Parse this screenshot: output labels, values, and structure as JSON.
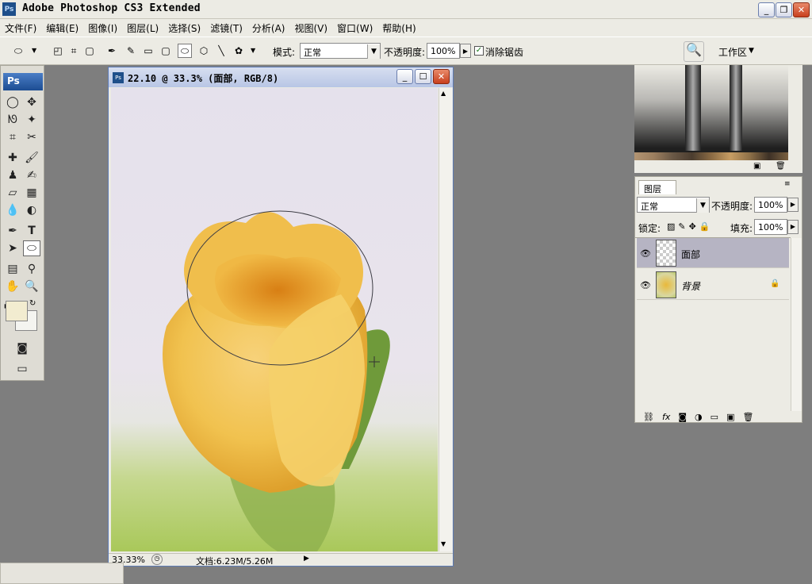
{
  "app": {
    "title": "Adobe Photoshop CS3 Extended",
    "logo": "Ps"
  },
  "window_buttons": {
    "minimize": "_",
    "restore": "❐",
    "close": "✕"
  },
  "menu": [
    "文件(F)",
    "编辑(E)",
    "图像(I)",
    "图层(L)",
    "选择(S)",
    "滤镜(T)",
    "分析(A)",
    "视图(V)",
    "窗口(W)",
    "帮助(H)"
  ],
  "options": {
    "mode_label": "模式:",
    "mode_value": "正常",
    "opacity_label": "不透明度:",
    "opacity_value": "100%",
    "antialias_label": "消除锯齿",
    "workspace_label": "工作区"
  },
  "toolbox": {
    "logo": "Ps"
  },
  "document": {
    "title": "22.10 @ 33.3% (面部, RGB/8)",
    "zoom": "33.33%",
    "doc_size": "文档:6.23M/5.26M"
  },
  "layers_panel": {
    "tab_label": "图层",
    "blend_mode": "正常",
    "opacity_label": "不透明度:",
    "opacity_value": "100%",
    "lock_label": "锁定:",
    "fill_label": "填充:",
    "fill_value": "100%",
    "layers": [
      {
        "name": "面部",
        "selected": true
      },
      {
        "name": "背景",
        "italic": true,
        "locked": true
      }
    ],
    "footer_icons": [
      "link-icon",
      "fx-icon",
      "mask-icon",
      "adjustment-icon",
      "folder-icon",
      "new-layer-icon",
      "trash-icon"
    ]
  },
  "colors": {
    "foreground": "#f2ecd0",
    "background": "#f4f4f0",
    "accent": "#2b55a5"
  }
}
